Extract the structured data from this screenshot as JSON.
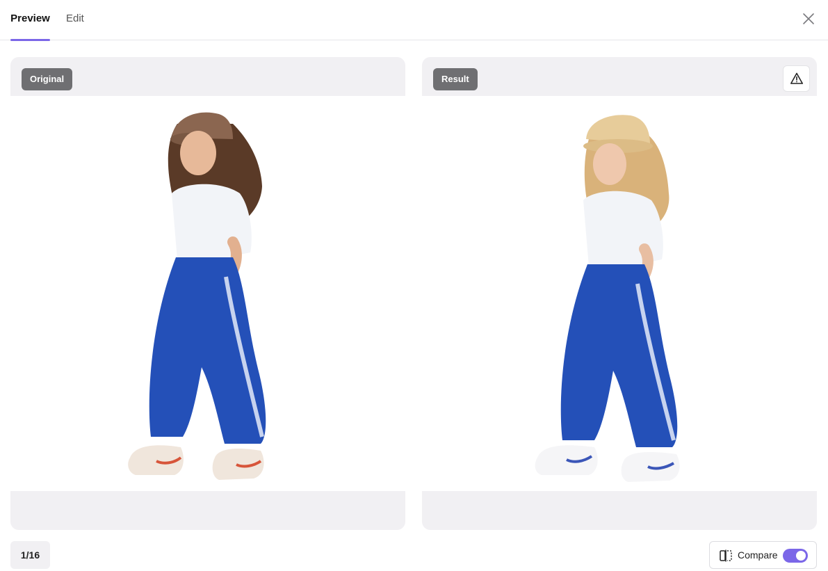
{
  "tabs": {
    "preview": "Preview",
    "edit": "Edit"
  },
  "panels": {
    "original": {
      "badge": "Original"
    },
    "result": {
      "badge": "Result"
    }
  },
  "pager": {
    "label": "1/16"
  },
  "compare": {
    "label": "Compare",
    "enabled": true
  },
  "icons": {
    "close": "close-icon",
    "warning": "warning-icon",
    "compare": "compare-split-icon"
  },
  "colors": {
    "accent": "#7b67e8",
    "badge_bg": "#6f6f72",
    "panel_bg": "#f1f0f3"
  }
}
